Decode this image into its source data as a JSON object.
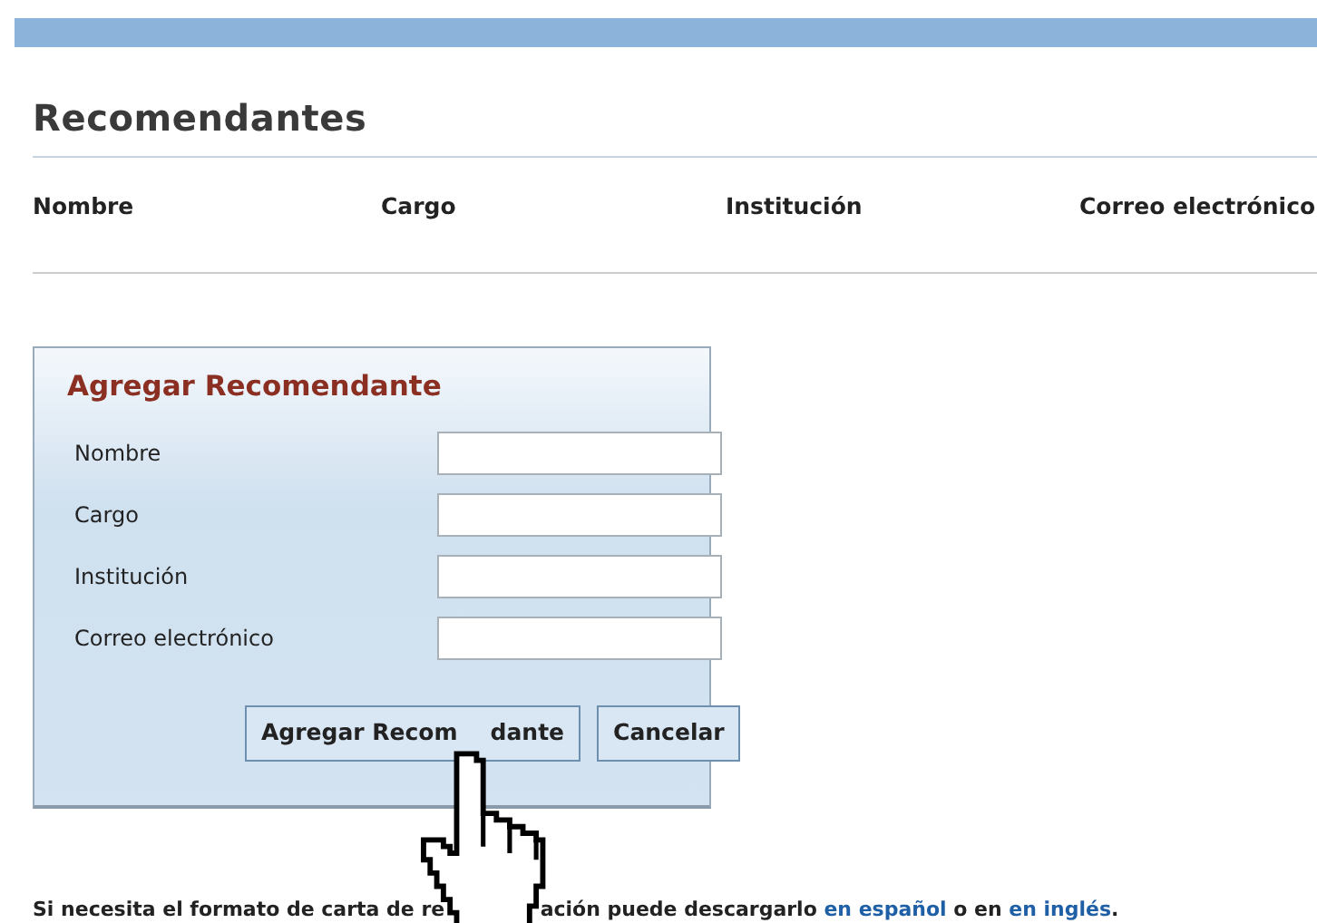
{
  "heading": "Recomendantes",
  "table": {
    "columns": [
      "Nombre",
      "Cargo",
      "Institución",
      "Correo electrónico"
    ]
  },
  "form": {
    "title": "Agregar Recomendante",
    "fields": [
      {
        "label": "Nombre"
      },
      {
        "label": "Cargo"
      },
      {
        "label": "Institución"
      },
      {
        "label": "Correo electrónico"
      }
    ],
    "buttons": [
      {
        "label_parts": [
          "Agregar Recom",
          "dante"
        ]
      },
      {
        "label_parts": [
          "Cancelar"
        ]
      }
    ]
  },
  "footer": {
    "text_parts": [
      "Si necesita el formato de carta de re",
      "ación puede descargarlo "
    ],
    "link_1": "en español",
    "middle": " o en ",
    "link_2": "en inglés",
    "end": "."
  }
}
